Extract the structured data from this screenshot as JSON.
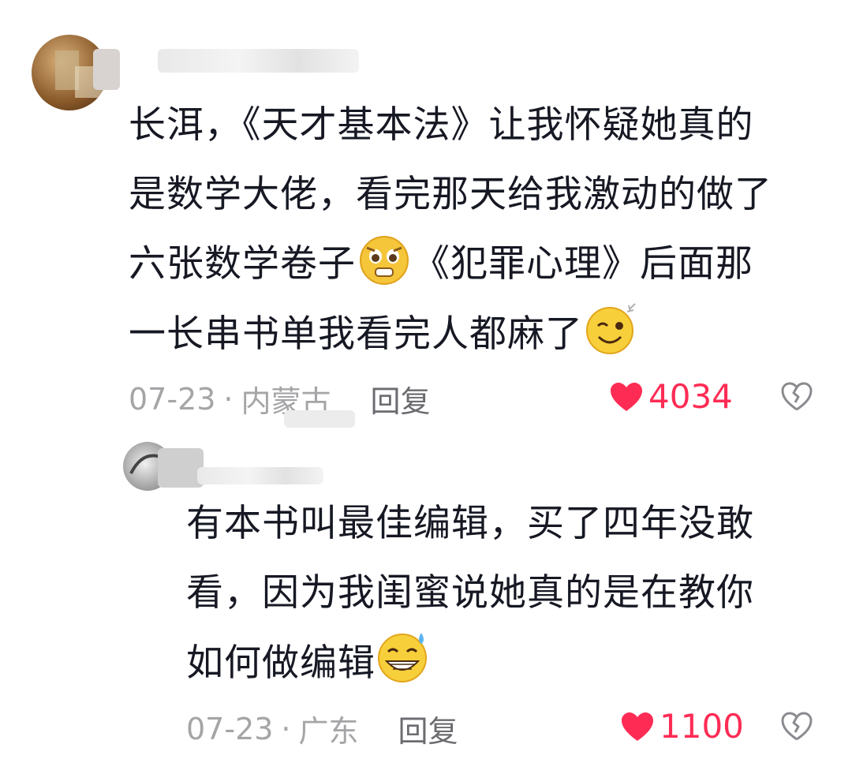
{
  "comments": [
    {
      "text_lines": [
        "长洱，《天才基本法》让我怀疑她真的",
        "是数学大佬，看完那天给我激动的做了",
        "六张数学卷子",
        "《犯罪心理》后面那",
        "一长串书单我看完人都麻了"
      ],
      "date": "07-23",
      "location": "内蒙古",
      "reply_label": "回复",
      "likes": "4034",
      "emojis": [
        "crying-face-emoji",
        "grinning-sparkle-emoji"
      ]
    },
    {
      "text_lines": [
        "有本书叫最佳编辑，买了四年没敢",
        "看，因为我闺蜜说她真的是在教你",
        "如何做编辑"
      ],
      "date": "07-23",
      "location": "广东",
      "reply_label": "回复",
      "likes": "1100",
      "emojis": [
        "grin-sweat-emoji"
      ]
    }
  ],
  "separator": "·",
  "colors": {
    "like": "#fe2c55",
    "meta": "#a5a5a8",
    "text": "#161823"
  },
  "icons": [
    "heart-icon",
    "broken-heart-icon"
  ]
}
